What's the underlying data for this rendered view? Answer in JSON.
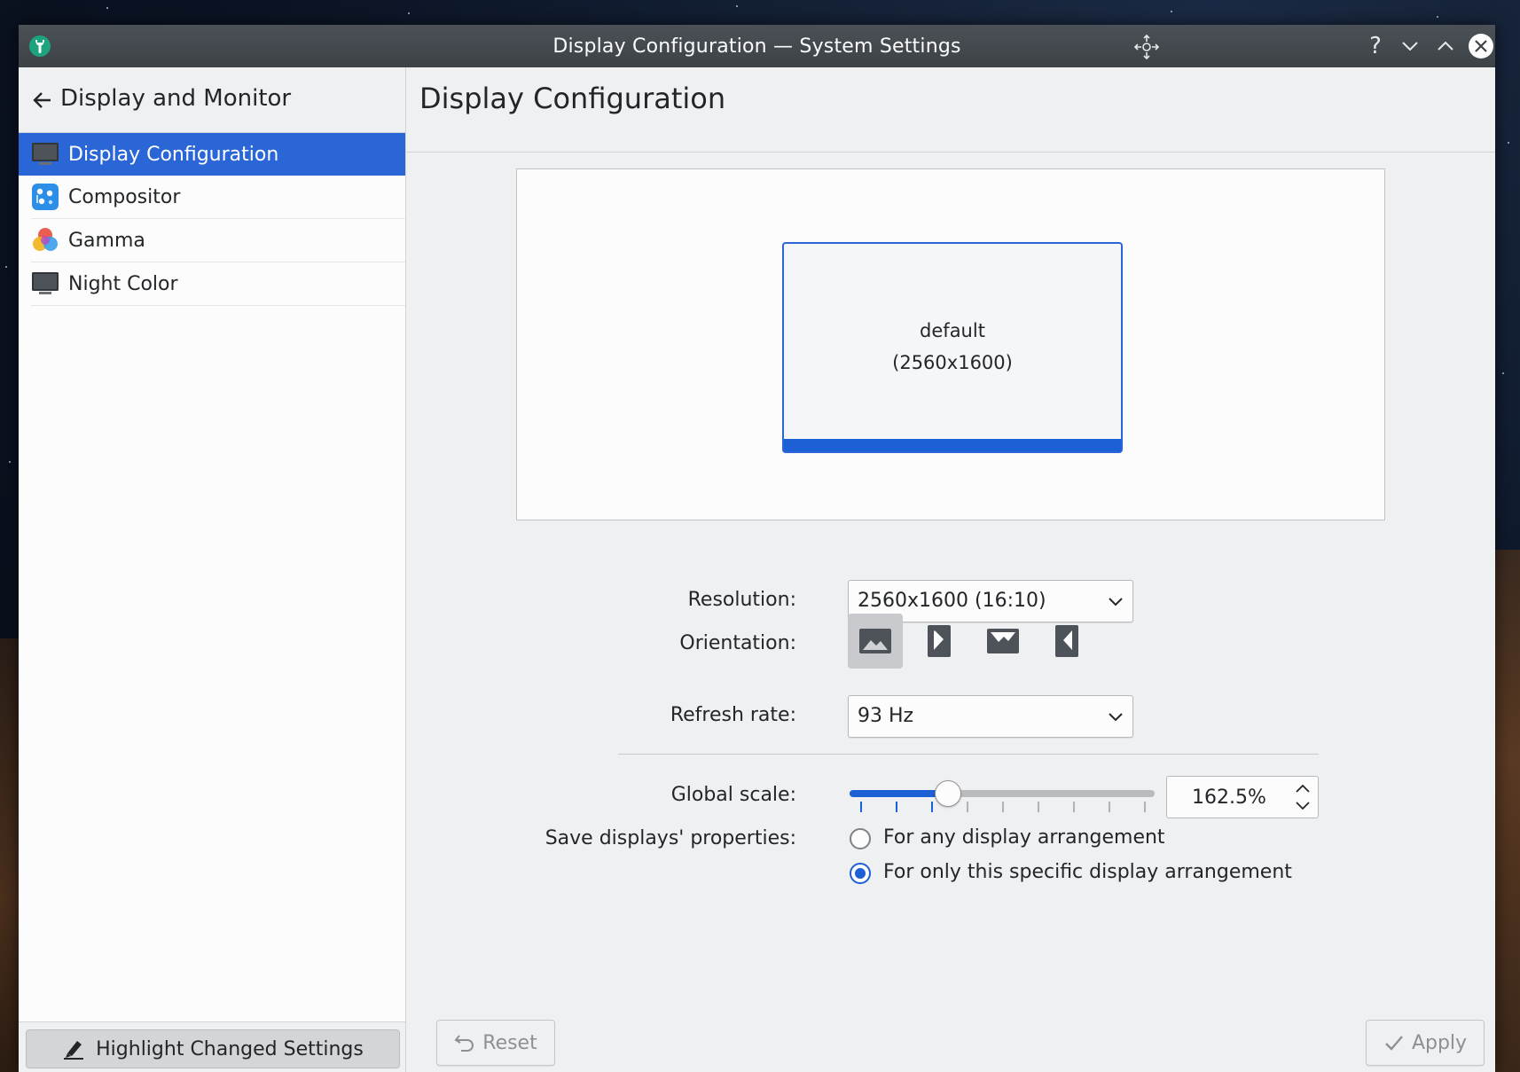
{
  "window": {
    "title": "Display Configuration — System Settings",
    "help_glyph": "?"
  },
  "sidebar": {
    "header_title": "Display and Monitor",
    "items": [
      {
        "label": "Display Configuration",
        "icon": "monitor-icon",
        "selected": true
      },
      {
        "label": "Compositor",
        "icon": "compositor-icon",
        "selected": false
      },
      {
        "label": "Gamma",
        "icon": "gamma-icon",
        "selected": false
      },
      {
        "label": "Night Color",
        "icon": "monitor-icon",
        "selected": false
      }
    ],
    "footer_button": "Highlight Changed Settings"
  },
  "main": {
    "page_title": "Display Configuration",
    "preview": {
      "output_name": "default",
      "output_resolution": "(2560x1600)"
    },
    "form": {
      "resolution_label": "Resolution:",
      "resolution_value": "2560x1600 (16:10)",
      "orientation_label": "Orientation:",
      "orientation_selected": "landscape",
      "refresh_label": "Refresh rate:",
      "refresh_value": "93 Hz",
      "scale_label": "Global scale:",
      "scale_value": "162.5%",
      "scale_slider_fraction": 0.32,
      "save_label": "Save displays' properties:",
      "save_option_any": "For any display arrangement",
      "save_option_specific": "For only this specific display arrangement",
      "save_selected": "specific"
    },
    "buttons": {
      "reset": "Reset",
      "apply": "Apply"
    }
  },
  "colors": {
    "accent": "#2a66d6",
    "titlebar": "#3c4246",
    "window_bg": "#eff0f1"
  }
}
